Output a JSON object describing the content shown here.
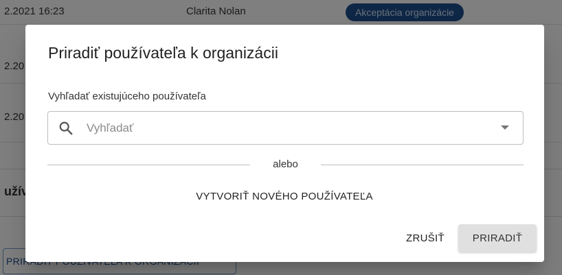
{
  "background": {
    "rows": [
      {
        "date": "2.2021 16:23",
        "name": "Clarita Nolan",
        "badge": "Akceptácia organizácie"
      },
      {
        "date": "2.20"
      },
      {
        "date": "2.20"
      }
    ],
    "section_title": "užív",
    "outline_button": "PRIRADIŤ POUŽÍVATEĽA K ORGANIZÁCII"
  },
  "dialog": {
    "title": "Priradiť používateľa k organizácii",
    "field_label": "Vyhľadať existujúceho používateľa",
    "search": {
      "placeholder": "Vyhľadať",
      "value": "",
      "icon": "search-icon"
    },
    "divider_text": "alebo",
    "create_button": "VYTVORIŤ NOVÉHO POUŽÍVATEĽA",
    "cancel_button": "ZRUŠIŤ",
    "assign_button": "PRIRADIŤ"
  },
  "colors": {
    "badge_bg": "#1e4f8c",
    "scrim": "rgba(0,0,0,0.5)",
    "primary_button_bg": "#e0e0e0"
  }
}
